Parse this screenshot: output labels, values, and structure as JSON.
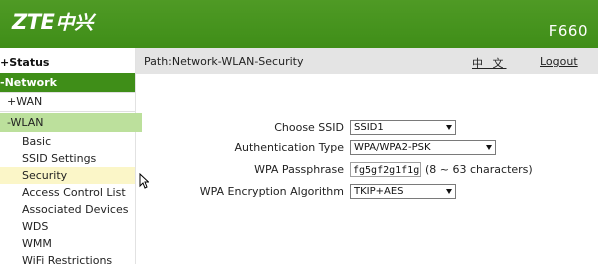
{
  "header": {
    "brand_latin": "ZTE",
    "brand_cn": "中兴",
    "model": "F660"
  },
  "sidebar": {
    "status": "+Status",
    "network": "-Network",
    "wan": "+WAN",
    "wlan": "-WLAN",
    "wlan_items": [
      "Basic",
      "SSID Settings",
      "Security",
      "Access Control List",
      "Associated Devices",
      "WDS",
      "WMM",
      "WiFi Restrictions"
    ]
  },
  "topbar": {
    "path": "Path:Network-WLAN-Security",
    "language": "中 文",
    "logout": "Logout"
  },
  "form": {
    "choose_ssid_label": "Choose SSID",
    "choose_ssid_value": "SSID1",
    "auth_type_label": "Authentication Type",
    "auth_type_value": "WPA/WPA2-PSK",
    "passphrase_label": "WPA Passphrase",
    "passphrase_value": "fg5gf2g1f1g",
    "passphrase_hint": "(8 ~ 63 characters)",
    "encryption_label": "WPA Encryption Algorithm",
    "encryption_value": "TKIP+AES"
  }
}
